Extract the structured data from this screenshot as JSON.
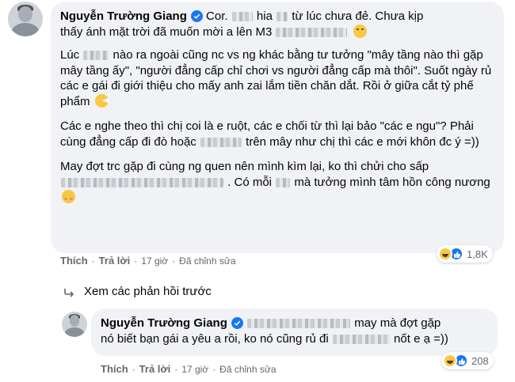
{
  "comment1": {
    "author": "Nguyễn Trường Giang",
    "line1a": "Cor.",
    "line1b": "hia",
    "line1c": "từ lúc chưa đẻ. Chưa kịp",
    "line2a": "thấy ánh mặt trời đã muốn mời a lên M3",
    "p2a": "Lúc",
    "p2b": "nào ra ngoài cũng nc vs ng khác bằng tư tưởng \"mây tầng nào thì gặp mây tầng ấy\", \"người đẳng cấp chỉ chơi vs người đẳng cấp mà thôi\". Suốt ngày rủ các e gái đi giới thiệu cho mấy anh zai lắm tiền chăn dắt. Rồi ở giữa cắt tỷ phế phẩm",
    "p3a": "Các e nghe theo thì chị coi là e ruột, các e chối từ thì lại bảo \"các e ngu\"? Phải cùng đẳng cấp đi đò hoặc",
    "p3b": "trên mây như chị thì các e mới khôn đc ý =))",
    "p4a": "May đợt trc gặp đi cùng ng quen nên mình kìm lại, ko thì chửi cho sấp",
    "p4b": ". Có mỗi",
    "p4c": "mà tưởng mình tâm hồn công nương",
    "like_label": "Thích",
    "reply_label": "Trả lời",
    "time": "17 giờ",
    "edited": "Đã chỉnh sửa",
    "reaction_count": "1,8K"
  },
  "view_previous": "Xem các phản hồi trước",
  "comment2": {
    "author": "Nguyễn Trường Giang",
    "line1a": "may mà đợt gặp",
    "line2a": "nó biết bạn gái a yêu a rồi, ko nó cũng rủ đi",
    "line2b": "nốt e ạ =))",
    "like_label": "Thích",
    "reply_label": "Trả lời",
    "time": "17 giờ",
    "edited": "Đã chỉnh sửa",
    "reaction_count": "208"
  },
  "colors": {
    "bubble": "#f0f2f5",
    "verified": "#1877f2",
    "secondary_text": "#65676b"
  },
  "icons": [
    "verified-badge-icon",
    "haha-reaction-icon",
    "like-reaction-icon",
    "reply-arrow-icon",
    "tired-emoji-icon",
    "pacman-emoji-icon",
    "blush-emoji-icon"
  ]
}
